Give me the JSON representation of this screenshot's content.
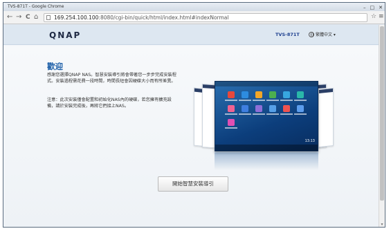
{
  "window": {
    "title": "TVS-871T - Google Chrome",
    "controls": [
      "–",
      "□",
      "✕"
    ]
  },
  "browser": {
    "back": "←",
    "forward": "→",
    "reload": "C",
    "home": "⌂",
    "url_host": "169.254.100.100",
    "url_rest": ":8080/cgi-bin/quick/html/index.html#indexNormal",
    "star": "☆",
    "menu": "≡"
  },
  "header": {
    "logo": "QNAP",
    "model": "TVS-871T",
    "language": "繁體中文 ▾"
  },
  "welcome": {
    "title": "歡迎",
    "intro": "感謝您選擇QNAP NAS。智慧安裝導引將會帶著您一步步完成安裝程式。安裝過程需花費一段時間，時間長短會因硬碟大小而有所差異。",
    "note": "注意：此次安裝僅會配置和初始化NAS內的硬碟，若您擁有擴充設備，請於安裝完成後，再將它們接上NAS。"
  },
  "actions": {
    "start_label": "開始智慧安裝導引"
  },
  "mockup": {
    "clock": "13:13",
    "app_colors": [
      "#e8483b",
      "#2d8ce0",
      "#f2a627",
      "#4caf50",
      "#37a7e0",
      "#2ab7a9",
      "#f06292",
      "#3f7fe0",
      "#8e6fd8",
      "#56a0e8",
      "#ef5350",
      "#5c9ded",
      "#e04fb3"
    ]
  }
}
